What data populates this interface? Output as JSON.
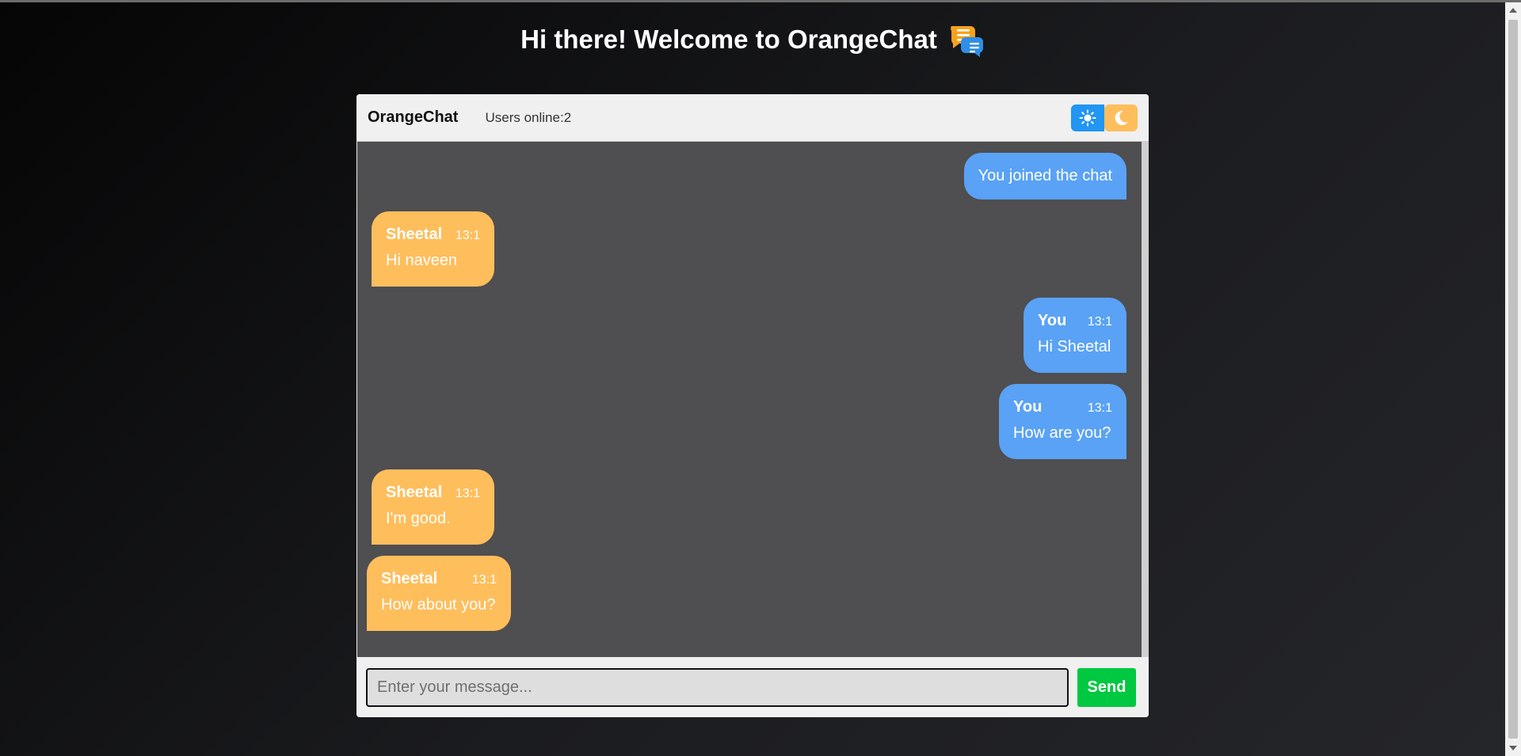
{
  "page": {
    "title": "Hi there! Welcome to OrangeChat",
    "title_icon": "chat-bubbles-icon"
  },
  "header": {
    "brand": "OrangeChat",
    "online_label": "Users online:",
    "online_count": "2",
    "light_icon": "sun-icon",
    "dark_icon": "moon-icon"
  },
  "messages": [
    {
      "type": "system",
      "from": "me",
      "text": "You joined the chat"
    },
    {
      "type": "message",
      "from": "other",
      "sender": "Sheetal",
      "time": "13:1",
      "text": "Hi naveen"
    },
    {
      "type": "message",
      "from": "me",
      "sender": "You",
      "time": "13:1",
      "text": "Hi Sheetal"
    },
    {
      "type": "message",
      "from": "me",
      "sender": "You",
      "time": "13:1",
      "text": "How are you?"
    },
    {
      "type": "message",
      "from": "other",
      "sender": "Sheetal",
      "time": "13:1",
      "text": "I'm good."
    },
    {
      "type": "message",
      "from": "other",
      "sender": "Sheetal",
      "time": "13:1",
      "text": "How about you?"
    }
  ],
  "composer": {
    "placeholder": "Enter your message...",
    "value": "",
    "send_label": "Send"
  },
  "colors": {
    "my_bubble": "#5aa2f5",
    "other_bubble": "#ffbe5c",
    "send_button": "#00c840",
    "light_toggle": "#2196f3",
    "dark_toggle": "#ffbe5c"
  }
}
